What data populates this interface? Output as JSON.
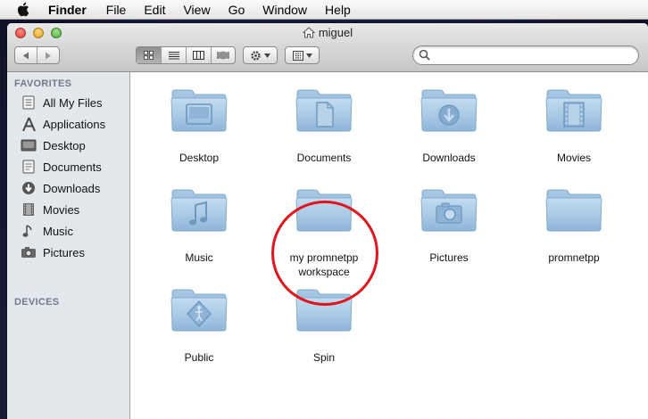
{
  "menubar": {
    "apple_icon": "apple-icon",
    "items": [
      "Finder",
      "File",
      "Edit",
      "View",
      "Go",
      "Window",
      "Help"
    ]
  },
  "window": {
    "title": "miguel",
    "title_icon": "home-icon"
  },
  "toolbar": {
    "nav": [
      "back-icon",
      "forward-icon"
    ],
    "view_modes": [
      "icon-view-icon",
      "list-view-icon",
      "column-view-icon",
      "cover-flow-icon"
    ],
    "active_view": "icon",
    "action_icon": "gear-icon",
    "arrange_icon": "arrange-icon",
    "search": {
      "value": "",
      "placeholder": ""
    }
  },
  "sidebar": {
    "favorites_header": "FAVORITES",
    "devices_header": "DEVICES",
    "items": [
      {
        "label": "All My Files",
        "icon": "all-files-icon"
      },
      {
        "label": "Applications",
        "icon": "applications-icon"
      },
      {
        "label": "Desktop",
        "icon": "desktop-icon"
      },
      {
        "label": "Documents",
        "icon": "documents-icon"
      },
      {
        "label": "Downloads",
        "icon": "downloads-icon"
      },
      {
        "label": "Movies",
        "icon": "movies-icon"
      },
      {
        "label": "Music",
        "icon": "music-icon"
      },
      {
        "label": "Pictures",
        "icon": "pictures-icon"
      }
    ]
  },
  "files": [
    {
      "name": "Desktop",
      "icon": "desktop-folder-icon"
    },
    {
      "name": "Documents",
      "icon": "documents-folder-icon"
    },
    {
      "name": "Downloads",
      "icon": "downloads-folder-icon"
    },
    {
      "name": "Movies",
      "icon": "movies-folder-icon"
    },
    {
      "name": "Music",
      "icon": "music-folder-icon"
    },
    {
      "name": "my promnetpp workspace",
      "icon": "folder-icon"
    },
    {
      "name": "Pictures",
      "icon": "pictures-folder-icon"
    },
    {
      "name": "promnetpp",
      "icon": "folder-icon"
    },
    {
      "name": "Public",
      "icon": "public-folder-icon"
    },
    {
      "name": "Spin",
      "icon": "folder-icon"
    }
  ],
  "annotation": {
    "highlighted_item": "my promnetpp workspace",
    "color": "#e0161c"
  },
  "colors": {
    "folder": "#9fc3e0",
    "folder_dark": "#7aa6cb",
    "sidebar_bg": "#e3e8ed"
  }
}
